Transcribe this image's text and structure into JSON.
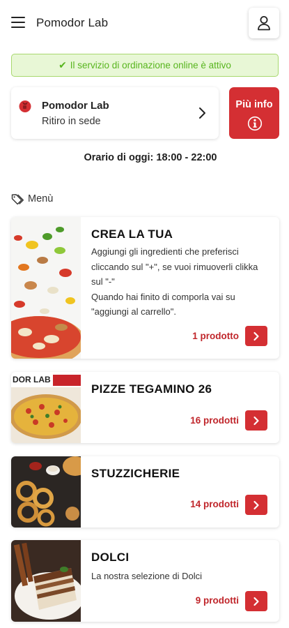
{
  "header": {
    "title": "Pomodor Lab",
    "menu_icon": "hamburger-menu-icon",
    "user_icon": "user-icon"
  },
  "status": {
    "text": "Il servizio di ordinazione online è attivo",
    "icon": "check-icon",
    "check_glyph": "✔",
    "color": "#58b51e"
  },
  "store": {
    "name": "Pomodor Lab",
    "mode": "Ritiro in sede",
    "logo_icon": "tomato-logo-icon",
    "chevron_icon": "chevron-right-icon"
  },
  "info_button": {
    "label": "Più info",
    "icon": "info-circle-icon"
  },
  "hours": {
    "text": "Orario di oggi: 18:00 - 22:00"
  },
  "menu": {
    "heading": "Menù",
    "heading_icon": "tag-icon",
    "categories": [
      {
        "title": "CREA LA TUA",
        "description": "Aggiungi gli ingredienti che preferisci cliccando sul \"+\", se vuoi rimuoverli clikka sul \"-\"\nQuando hai finito di comporla vai su \"aggiungi al carrello\".",
        "count": "1 prodotto"
      },
      {
        "title": "PIZZE TEGAMINO 26",
        "count": "16 prodotti",
        "image_text": "DOR LAB"
      },
      {
        "title": "STUZZICHERIE",
        "count": "14 prodotti"
      },
      {
        "title": "DOLCI",
        "description": "La nostra selezione di Dolci",
        "count": "9 prodotti"
      }
    ]
  },
  "colors": {
    "accent_red": "#d42f33",
    "count_red": "#c0262b",
    "banner_bg": "#e8f7d6",
    "banner_border": "#a8d86e"
  }
}
